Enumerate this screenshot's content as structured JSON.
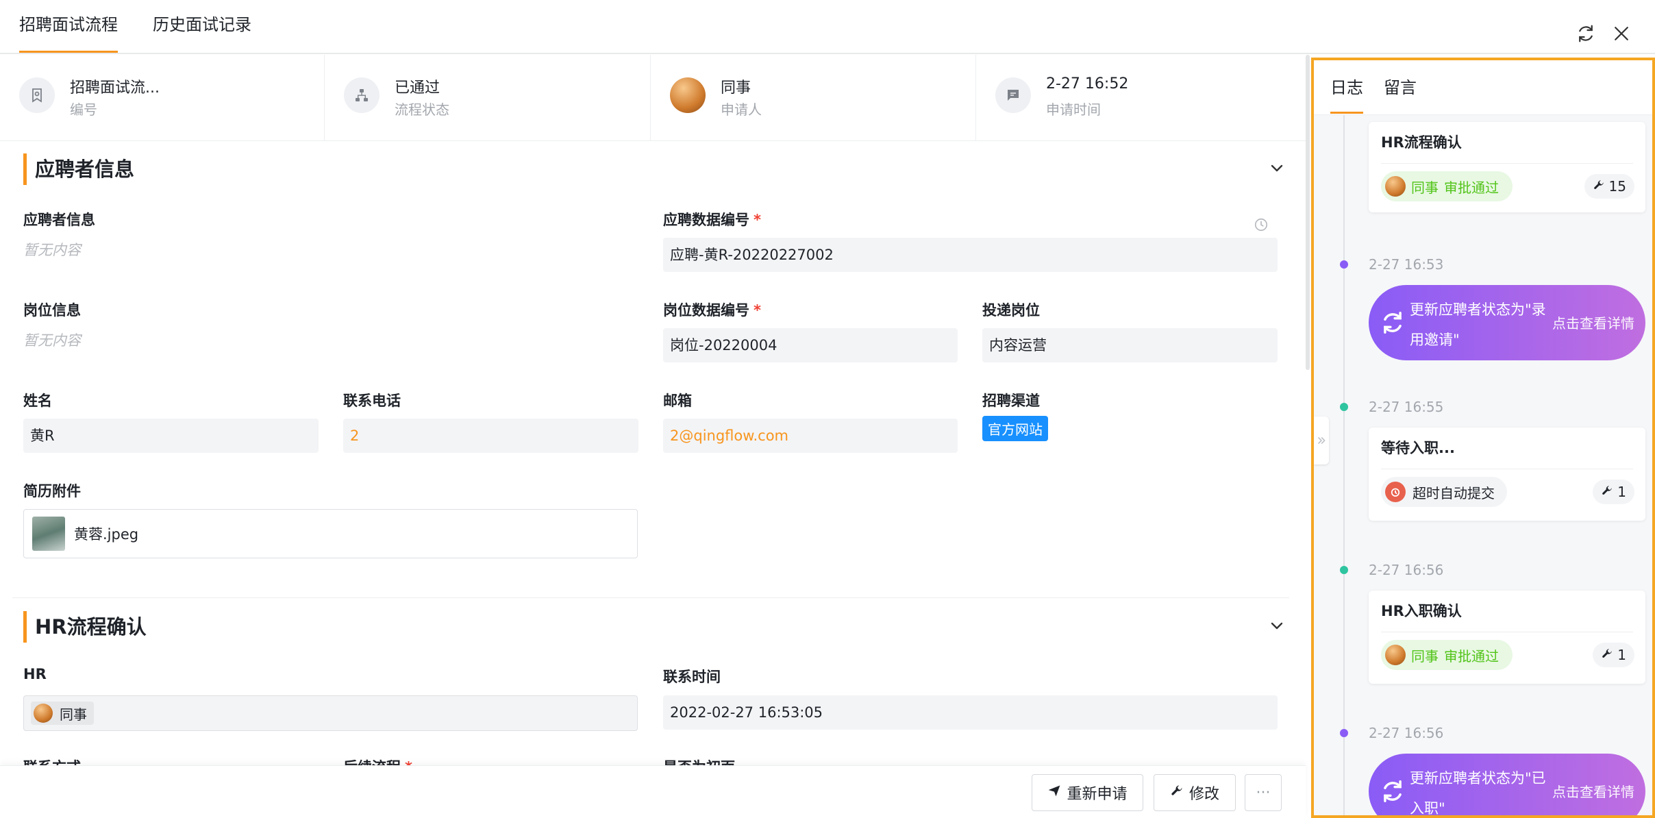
{
  "tabs": {
    "process": "招聘面试流程",
    "history": "历史面试记录"
  },
  "summary": {
    "number_value": "招聘面试流...",
    "number_label": "编号",
    "status_value": "已通过",
    "status_label": "流程状态",
    "applicant_value": "同事",
    "applicant_label": "申请人",
    "time_value": "2-27 16:52",
    "time_label": "申请时间"
  },
  "section_applicant": {
    "title": "应聘者信息",
    "applicant_info_label": "应聘者信息",
    "applicant_info_empty": "暂无内容",
    "app_no_label": "应聘数据编号",
    "app_no_value": "应聘-黄R-20220227002",
    "position_info_label": "岗位信息",
    "position_info_empty": "暂无内容",
    "pos_no_label": "岗位数据编号",
    "pos_no_value": "岗位-20220004",
    "target_pos_label": "投递岗位",
    "target_pos_value": "内容运营",
    "name_label": "姓名",
    "name_value": "黄R",
    "phone_label": "联系电话",
    "phone_value": "2",
    "email_label": "邮箱",
    "email_value": "2@qingflow.com",
    "channel_label": "招聘渠道",
    "channel_value": "官方网站",
    "resume_label": "简历附件",
    "resume_file": "黄蓉.jpeg",
    "required_mark": "*"
  },
  "section_hr": {
    "title": "HR流程确认",
    "hr_label": "HR",
    "hr_value": "同事",
    "contact_time_label": "联系时间",
    "contact_time_value": "2022-02-27 16:53:05",
    "contact_method_label": "联系方式",
    "followup_label": "后续流程",
    "first_interview_label": "是否为初面"
  },
  "toolbar": {
    "reapply": "重新申请",
    "edit": "修改",
    "more": "···"
  },
  "right_panel": {
    "tabs": {
      "log": "日志",
      "comment": "留言"
    },
    "items": [
      {
        "title": "HR流程确认",
        "actor": "同事",
        "action": "审批通过",
        "count": "15"
      },
      {
        "time": "2-27 16:53",
        "text": "更新应聘者状态为\"录用邀请\"",
        "link": "点击查看详情"
      },
      {
        "time": "2-27 16:55",
        "title": "等待入职...",
        "action": "超时自动提交",
        "count": "1"
      },
      {
        "time": "2-27 16:56",
        "title": "HR入职确认",
        "actor": "同事",
        "action": "审批通过",
        "count": "1"
      },
      {
        "time": "2-27 16:56",
        "text": "更新应聘者状态为\"已入职\"",
        "link": "点击查看详情"
      }
    ]
  },
  "colors": {
    "accent": "#f7951e",
    "tag_blue": "#1890ff",
    "success": "#52c41a",
    "purple": "#8a5cf6",
    "panel_border": "#f5a623"
  }
}
